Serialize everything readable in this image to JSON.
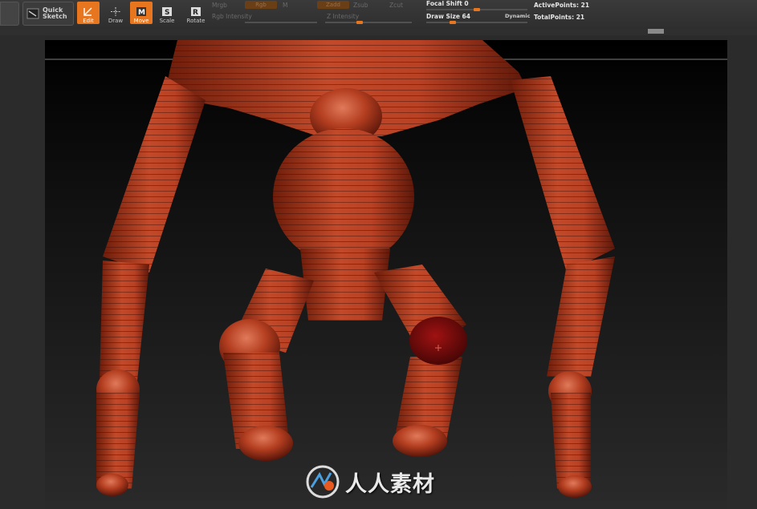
{
  "toolbar": {
    "quick_sketch": "Quick Sketch",
    "buttons": [
      {
        "label": "Edit",
        "icon": "edit-icon",
        "active": true
      },
      {
        "label": "Draw",
        "icon": "draw-icon",
        "active": false
      },
      {
        "label": "Move",
        "icon": "move-icon",
        "active": true
      },
      {
        "label": "Scale",
        "icon": "scale-icon",
        "active": false
      },
      {
        "label": "Rotate",
        "icon": "rotate-icon",
        "active": false
      }
    ],
    "mrgb": "Mrgb",
    "rgb": "Rgb",
    "m": "M",
    "rgb_intensity": "Rgb Intensity",
    "zadd": "Zadd",
    "zsub": "Zsub",
    "zcut": "Zcut",
    "z_intensity": "Z Intensity",
    "focal_shift": "Focal Shift 0",
    "draw_size": "Draw Size 64",
    "dynamic": "Dynamic",
    "active_points": "ActivePoints: 21",
    "total_points": "TotalPoints: 21",
    "accent_color": "#e8761e"
  },
  "watermark": {
    "text": "人人素材",
    "icon": "logo-icon"
  },
  "model": {
    "color": "#b8401e",
    "type": "zsphere-armature"
  }
}
